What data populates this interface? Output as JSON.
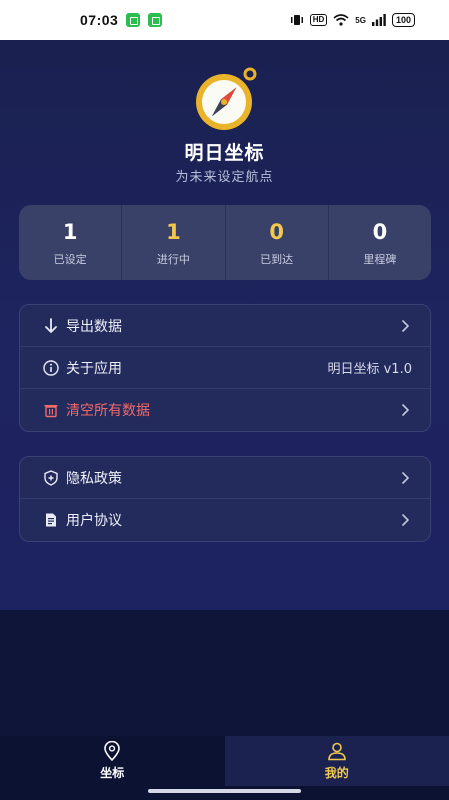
{
  "status_bar": {
    "time": "07:03",
    "hd": "HD",
    "network": "5G",
    "battery": "100"
  },
  "app": {
    "name": "明日坐标",
    "slogan": "为未来设定航点"
  },
  "stats": [
    {
      "value": "1",
      "label": "已设定",
      "color": "#ffffff"
    },
    {
      "value": "1",
      "label": "进行中",
      "color": "#f2c94c"
    },
    {
      "value": "0",
      "label": "已到达",
      "color": "#f2c94c"
    },
    {
      "value": "0",
      "label": "里程碑",
      "color": "#ffffff"
    }
  ],
  "settings_card": {
    "export": {
      "label": "导出数据",
      "icon": "arrow-down-icon"
    },
    "about": {
      "label": "关于应用",
      "value": "明日坐标 v1.0",
      "icon": "info-icon"
    },
    "clear": {
      "label": "清空所有数据",
      "icon": "trash-icon",
      "color": "#f26a6a"
    }
  },
  "legal_card": {
    "privacy": {
      "label": "隐私政策",
      "icon": "shield-plus-icon"
    },
    "agreement": {
      "label": "用户协议",
      "icon": "document-icon"
    }
  },
  "tabbar": {
    "tabs": [
      {
        "label": "坐标",
        "icon": "location-pin-icon",
        "active": false
      },
      {
        "label": "我的",
        "icon": "user-icon",
        "active": true
      }
    ]
  },
  "colors": {
    "background": "#1a2150",
    "accent": "#f2c94c",
    "danger": "#f26a6a"
  }
}
